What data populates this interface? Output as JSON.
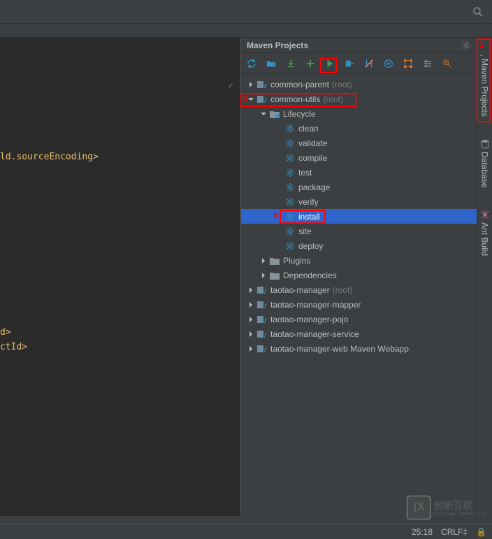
{
  "panel": {
    "title": "Maven Projects"
  },
  "side_tabs": {
    "maven": "Maven Projects",
    "database": "Database",
    "ant": "Ant Build"
  },
  "editor": {
    "lines": [
      "",
      "ld.sourceEncoding>",
      "",
      "",
      "",
      "",
      "",
      "",
      "",
      "",
      "",
      "d>",
      "ctId>"
    ]
  },
  "tree": {
    "roots": [
      {
        "label": "common-parent",
        "suffix": "(root)",
        "expanded": false
      },
      {
        "label": "common-utils",
        "suffix": "(root)",
        "expanded": true,
        "children": [
          {
            "label": "Lifecycle",
            "type": "folder",
            "expanded": true,
            "phases": [
              "clean",
              "validate",
              "compile",
              "test",
              "package",
              "verify",
              "install",
              "site",
              "deploy"
            ],
            "selected": "install"
          },
          {
            "label": "Plugins",
            "type": "folder",
            "expanded": false
          },
          {
            "label": "Dependencies",
            "type": "folder",
            "expanded": false
          }
        ]
      },
      {
        "label": "taotao-manager",
        "suffix": "(root)",
        "expanded": false
      },
      {
        "label": "taotao-manager-mapper",
        "suffix": "",
        "expanded": false
      },
      {
        "label": "taotao-manager-pojo",
        "suffix": "",
        "expanded": false
      },
      {
        "label": "taotao-manager-service",
        "suffix": "",
        "expanded": false
      },
      {
        "label": "taotao-manager-web Maven Webapp",
        "suffix": "",
        "expanded": false
      }
    ]
  },
  "status": {
    "pos": "25:18",
    "eol": "CRLF",
    "lock": "🔒"
  },
  "watermark": {
    "text": "创新互联",
    "sub": "CHUANG XINHULIAN",
    "logo": "(X"
  },
  "annotations": {
    "n1": "1",
    "n2": "2",
    "n3": "3"
  },
  "icons": {
    "check": "✓"
  }
}
